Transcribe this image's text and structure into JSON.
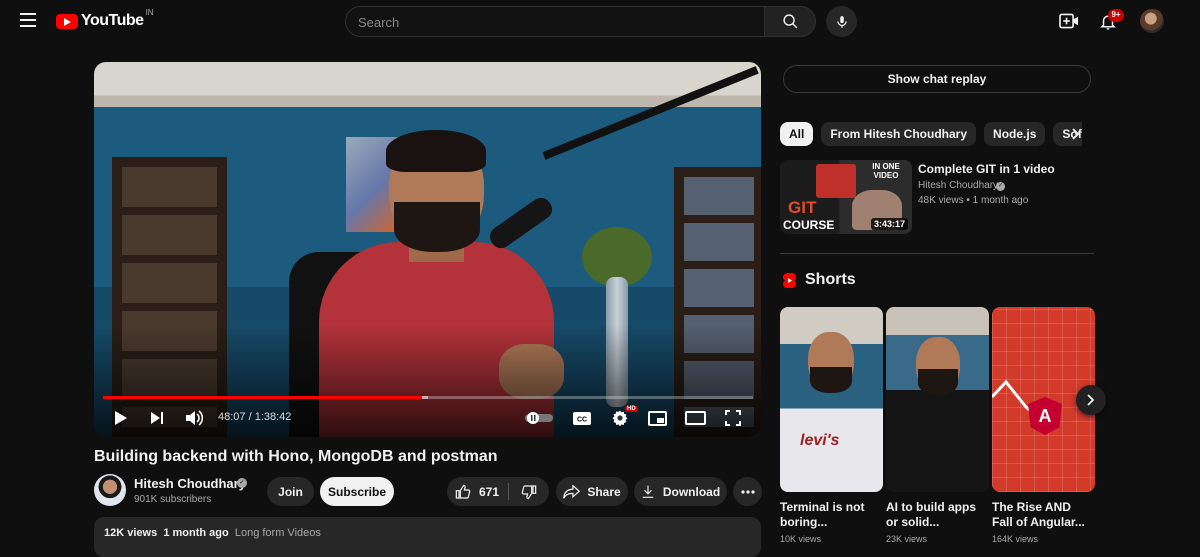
{
  "header": {
    "logo_text": "YouTube",
    "region": "IN",
    "search_placeholder": "Search",
    "notification_count": "9+"
  },
  "player": {
    "time_current": "48:07",
    "time_separator": " / ",
    "time_total": "1:38:42",
    "progress_played_fraction": 0.49,
    "progress_buffered_fraction": 0.5,
    "hd_label": "HD",
    "thumbnail_text": {
      "git": "GIT",
      "course": "COURSE"
    }
  },
  "video": {
    "title": "Building backend with Hono, MongoDB and postman",
    "channel_name": "Hitesh Choudhary",
    "subscribers": "901K subscribers",
    "join_label": "Join",
    "subscribe_label": "Subscribe",
    "like_count": "671",
    "share_label": "Share",
    "download_label": "Download",
    "views": "12K views",
    "uploaded": "1 month ago",
    "tag": "Long form Videos"
  },
  "sidebar": {
    "chat_replay_label": "Show chat replay",
    "chips": [
      "All",
      "From Hitesh Choudhary",
      "Node.js",
      "Softw"
    ],
    "recommendation": {
      "title": "Complete GIT in 1 video",
      "channel": "Hitesh Choudhary",
      "views": "48K views",
      "dot": "•",
      "age": "1 month ago",
      "duration": "3:43:17",
      "thumb_tag": "IN ONE VIDEO",
      "thumb_git": "GIT",
      "thumb_course": "COURSE"
    },
    "shorts_heading": "Shorts",
    "shorts": [
      {
        "title": "Terminal is not boring...",
        "views": "10K views",
        "overlay": "levi's"
      },
      {
        "title": "AI to build apps or solid...",
        "views": "23K views",
        "overlay": ""
      },
      {
        "title": "The Rise AND Fall of Angular...",
        "views": "164K views",
        "overlay": "A"
      }
    ]
  },
  "colors": {
    "background": "#0f0f0f",
    "brand_red": "#ff0000",
    "progress_red": "#ff0000",
    "chip_bg": "#272727",
    "text": "#f1f1f1",
    "muted": "#aaaaaa"
  },
  "icons": [
    "menu-icon",
    "youtube-logo-icon",
    "search-icon",
    "mic-icon",
    "create-icon",
    "bell-icon",
    "play-icon",
    "next-icon",
    "volume-icon",
    "autoplay-toggle-icon",
    "captions-icon",
    "settings-icon",
    "miniplayer-icon",
    "theater-icon",
    "fullscreen-icon",
    "thumbs-up-icon",
    "thumbs-down-icon",
    "share-icon",
    "download-icon",
    "more-icon",
    "chevron-right-icon",
    "shorts-icon",
    "verified-icon"
  ]
}
